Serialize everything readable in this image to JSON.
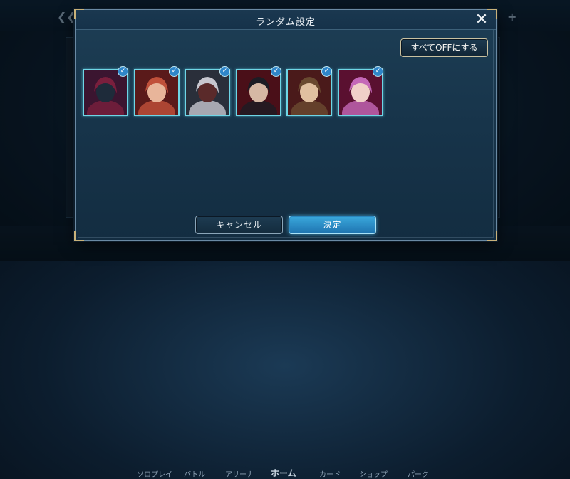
{
  "dialog": {
    "title": "ランダム設定",
    "all_off_label": "すべてOFFにする",
    "cancel_label": "キャンセル",
    "ok_label": "決定"
  },
  "characters": [
    {
      "name": "dragon-demon",
      "checked": true,
      "colors": [
        "#3b1530",
        "#7a1f3d",
        "#1e2b3a"
      ]
    },
    {
      "name": "red-haired-girl",
      "checked": true,
      "colors": [
        "#5a1a1a",
        "#c0503a",
        "#e8b59a"
      ]
    },
    {
      "name": "white-haired-man",
      "checked": true,
      "colors": [
        "#2a2f3a",
        "#c7c7cf",
        "#5a2a2a"
      ]
    },
    {
      "name": "dark-haired-man",
      "checked": true,
      "colors": [
        "#4a0f18",
        "#1c1c24",
        "#d6b8a4"
      ]
    },
    {
      "name": "brown-haired-man",
      "checked": true,
      "colors": [
        "#4a1a1a",
        "#6a4a30",
        "#e0c0a0"
      ]
    },
    {
      "name": "pink-haired-woman",
      "checked": true,
      "colors": [
        "#5a1030",
        "#c468b8",
        "#f0d0c8"
      ]
    }
  ],
  "background_nav": [
    "ソロプレイ",
    "バトル",
    "アリーナ",
    "ホーム",
    "カード",
    "ショップ",
    "パーク"
  ]
}
